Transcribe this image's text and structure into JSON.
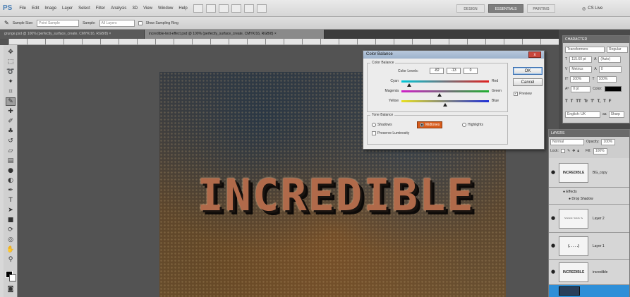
{
  "menubar": {
    "logo": "PS",
    "items": [
      "File",
      "Edit",
      "Image",
      "Layer",
      "Select",
      "Filter",
      "Analysis",
      "3D",
      "View",
      "Window",
      "Help"
    ],
    "workspaces": [
      "DESIGN",
      "ESSENTIALS",
      "PAINTING"
    ],
    "cs_live": "CS Live"
  },
  "options_bar": {
    "sample_size_label": "Sample Size:",
    "sample_size_value": "Point Sample",
    "sample_label": "Sample:",
    "sample_value": "All Layers",
    "show_ring_label": "Show Sampling Ring"
  },
  "doc_tabs": [
    "grunge.psd @ 100% (perfectly_surface_create, CMYK/16, RGB/8) ×",
    "incredible-text-effect.psd @ 100% (perfectly_surface_create, CMYK/16, RGB/8) ×"
  ],
  "artwork": {
    "text": "INCREDIBLE"
  },
  "dialog": {
    "title": "Color Balance",
    "close_label": "x",
    "color_balance_group": "Color Balance",
    "color_levels_label": "Color Levels:",
    "color_levels": [
      "-82",
      "-13",
      "0"
    ],
    "sliders": [
      {
        "left": "Cyan",
        "right": "Red",
        "value": -82,
        "color_left": "#00c8d8",
        "color_right": "#e02020"
      },
      {
        "left": "Magenta",
        "right": "Green",
        "value": -13,
        "color_left": "#d020c8",
        "color_right": "#20b030"
      },
      {
        "left": "Yellow",
        "right": "Blue",
        "value": 0,
        "color_left": "#e8e020",
        "color_right": "#2030d8"
      }
    ],
    "tone_balance_group": "Tone Balance",
    "tones": [
      "Shadows",
      "Midtones",
      "Highlights"
    ],
    "selected_tone": "Midtones",
    "preserve_luminosity": "Preserve Luminosity",
    "ok_label": "OK",
    "cancel_label": "Cancel",
    "preview_label": "Preview"
  },
  "character_panel": {
    "title": "CHARACTER",
    "font_family": "Transformers",
    "font_style": "Regular",
    "size": "115.60 pt",
    "leading": "(Auto)",
    "tracking": "0",
    "kerning": "Metrics",
    "vscale": "100%",
    "hscale": "100%",
    "baseline": "0 pt",
    "color_label": "Color:",
    "type_styles": [
      "T",
      "T",
      "TT",
      "Tr",
      "T'",
      "T,",
      "T",
      "F"
    ],
    "language": "English: UK",
    "aa_label": "aa",
    "aa_value": "Sharp"
  },
  "layers_panel": {
    "title": "LAYERS",
    "blend_mode": "Normal",
    "opacity_label": "Opacity:",
    "opacity": "100%",
    "lock_label": "Lock:",
    "fill_label": "Fill:",
    "fill": "100%",
    "layers": [
      {
        "name": "BG_copy",
        "thumb": "INCREDIBLE"
      },
      {
        "name": "Layer 2",
        "thumb": "~~~~ ~~~ ~"
      },
      {
        "name": "Layer 1",
        "thumb": "(. . . . .)"
      },
      {
        "name": "incredible",
        "thumb": "INCREDIBLE"
      }
    ],
    "effects_label": "Effects",
    "drop_shadow_label": "Drop Shadow"
  }
}
